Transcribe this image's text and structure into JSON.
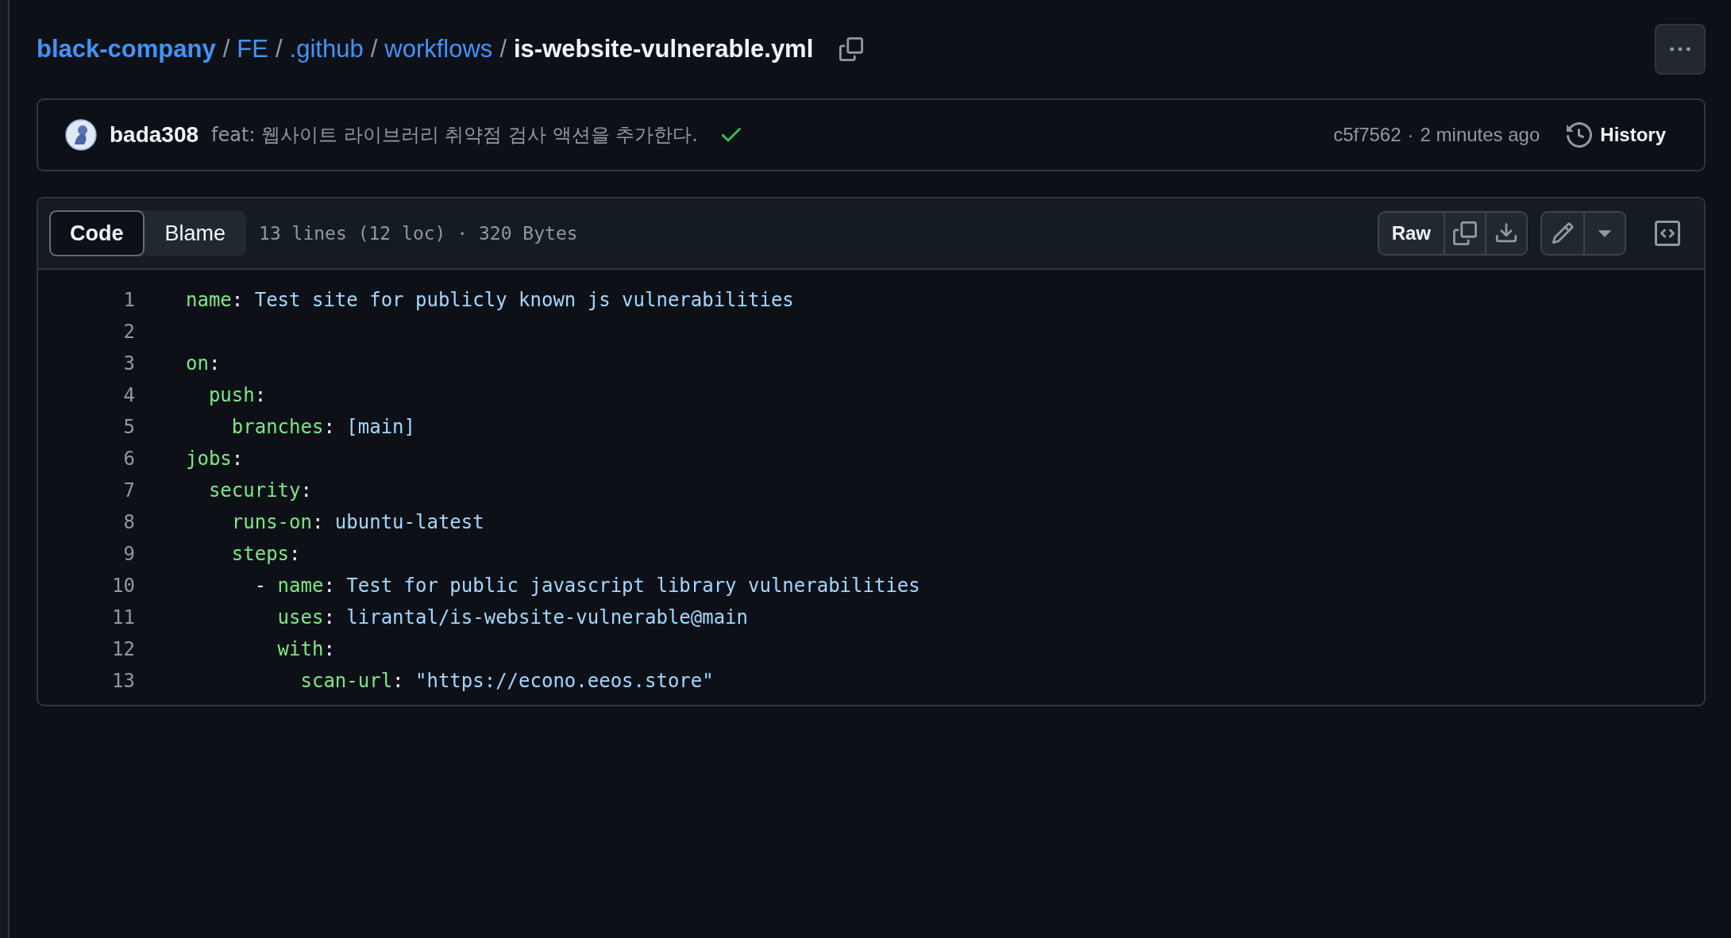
{
  "breadcrumb": {
    "parts": [
      "black-company",
      "FE",
      ".github",
      "workflows"
    ],
    "separator": "/",
    "current": "is-website-vulnerable.yml"
  },
  "commit": {
    "author": "bada308",
    "message": "feat: 웹사이트 라이브러리 취약점 검사 액션을 추가한다.",
    "checks_passed": true,
    "sha": "c5f7562",
    "separator": "·",
    "time": "2 minutes ago",
    "history_label": "History"
  },
  "file": {
    "tabs": [
      {
        "label": "Code",
        "selected": true
      },
      {
        "label": "Blame",
        "selected": false
      }
    ],
    "info": "13 lines (12 loc) · 320 Bytes",
    "raw_label": "Raw",
    "lines": [
      {
        "number": "1",
        "tokens": [
          {
            "kind": "key",
            "text": "name"
          },
          {
            "kind": "punct",
            "text": ": "
          },
          {
            "kind": "value",
            "text": "Test site for publicly known js vulnerabilities"
          }
        ]
      },
      {
        "number": "2"
      },
      {
        "number": "3",
        "tokens": [
          {
            "kind": "key",
            "text": "on"
          },
          {
            "kind": "punct",
            "text": ":"
          }
        ]
      },
      {
        "number": "4",
        "tokens": [
          {
            "kind": "key",
            "text": "  push"
          },
          {
            "kind": "punct",
            "text": ":"
          }
        ]
      },
      {
        "number": "5",
        "tokens": [
          {
            "kind": "key",
            "text": "    branches"
          },
          {
            "kind": "punct",
            "text": ": "
          },
          {
            "kind": "value",
            "text": "[main]"
          }
        ]
      },
      {
        "number": "6",
        "tokens": [
          {
            "kind": "key",
            "text": "jobs"
          },
          {
            "kind": "punct",
            "text": ":"
          }
        ]
      },
      {
        "number": "7",
        "tokens": [
          {
            "kind": "key",
            "text": "  security"
          },
          {
            "kind": "punct",
            "text": ":"
          }
        ]
      },
      {
        "number": "8",
        "tokens": [
          {
            "kind": "key",
            "text": "    runs-on"
          },
          {
            "kind": "punct",
            "text": ": "
          },
          {
            "kind": "value",
            "text": "ubuntu-latest"
          }
        ]
      },
      {
        "number": "9",
        "tokens": [
          {
            "kind": "key",
            "text": "    steps"
          },
          {
            "kind": "punct",
            "text": ":"
          }
        ]
      },
      {
        "number": "10",
        "tokens": [
          {
            "kind": "punct",
            "text": "      - "
          },
          {
            "kind": "key",
            "text": "name"
          },
          {
            "kind": "punct",
            "text": ": "
          },
          {
            "kind": "value",
            "text": "Test for public javascript library vulnerabilities"
          }
        ]
      },
      {
        "number": "11",
        "tokens": [
          {
            "kind": "key",
            "text": "        uses"
          },
          {
            "kind": "punct",
            "text": ": "
          },
          {
            "kind": "value",
            "text": "lirantal/is-website-vulnerable@main"
          }
        ]
      },
      {
        "number": "12",
        "tokens": [
          {
            "kind": "key",
            "text": "        with"
          },
          {
            "kind": "punct",
            "text": ":"
          }
        ]
      },
      {
        "number": "13",
        "tokens": [
          {
            "kind": "key",
            "text": "          scan-url"
          },
          {
            "kind": "punct",
            "text": ": "
          },
          {
            "kind": "value",
            "text": "\"https://econo.eeos.store\""
          }
        ]
      }
    ]
  }
}
